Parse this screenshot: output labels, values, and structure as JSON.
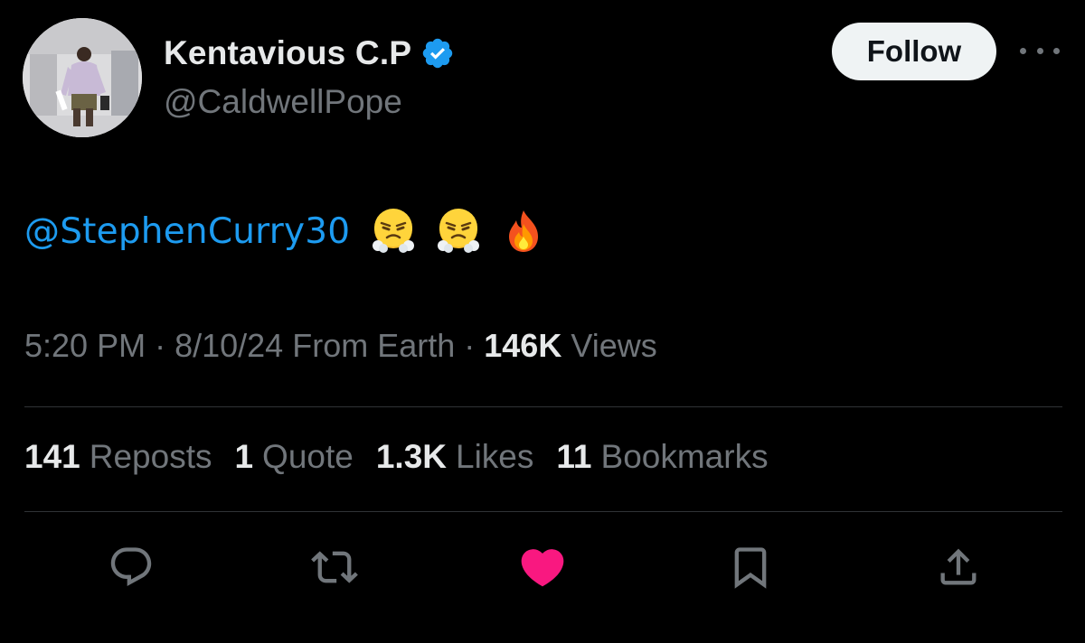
{
  "author": {
    "display_name": "Kentavious C.P",
    "handle": "@CaldwellPope",
    "verified": true
  },
  "follow_label": "Follow",
  "tweet": {
    "mention": "@StephenCurry30",
    "emojis": [
      "😤",
      "😤",
      "🔥"
    ]
  },
  "meta": {
    "time": "5:20 PM",
    "separator": " · ",
    "date": "8/10/24",
    "location": "From Earth",
    "views_count": "146K",
    "views_label": "Views"
  },
  "stats": {
    "reposts": {
      "count": "141",
      "label": "Reposts"
    },
    "quotes": {
      "count": "1",
      "label": "Quote"
    },
    "likes": {
      "count": "1.3K",
      "label": "Likes"
    },
    "bookmarks": {
      "count": "11",
      "label": "Bookmarks"
    }
  },
  "actions": [
    "reply-icon",
    "repost-icon",
    "like-icon",
    "bookmark-icon",
    "share-icon"
  ],
  "colors": {
    "background": "#000000",
    "text_primary": "#e7e9ea",
    "text_secondary": "#71767b",
    "link": "#1d9bf0",
    "like_active": "#f91880",
    "divider": "#2f3336",
    "follow_button_bg": "#eff3f4"
  }
}
